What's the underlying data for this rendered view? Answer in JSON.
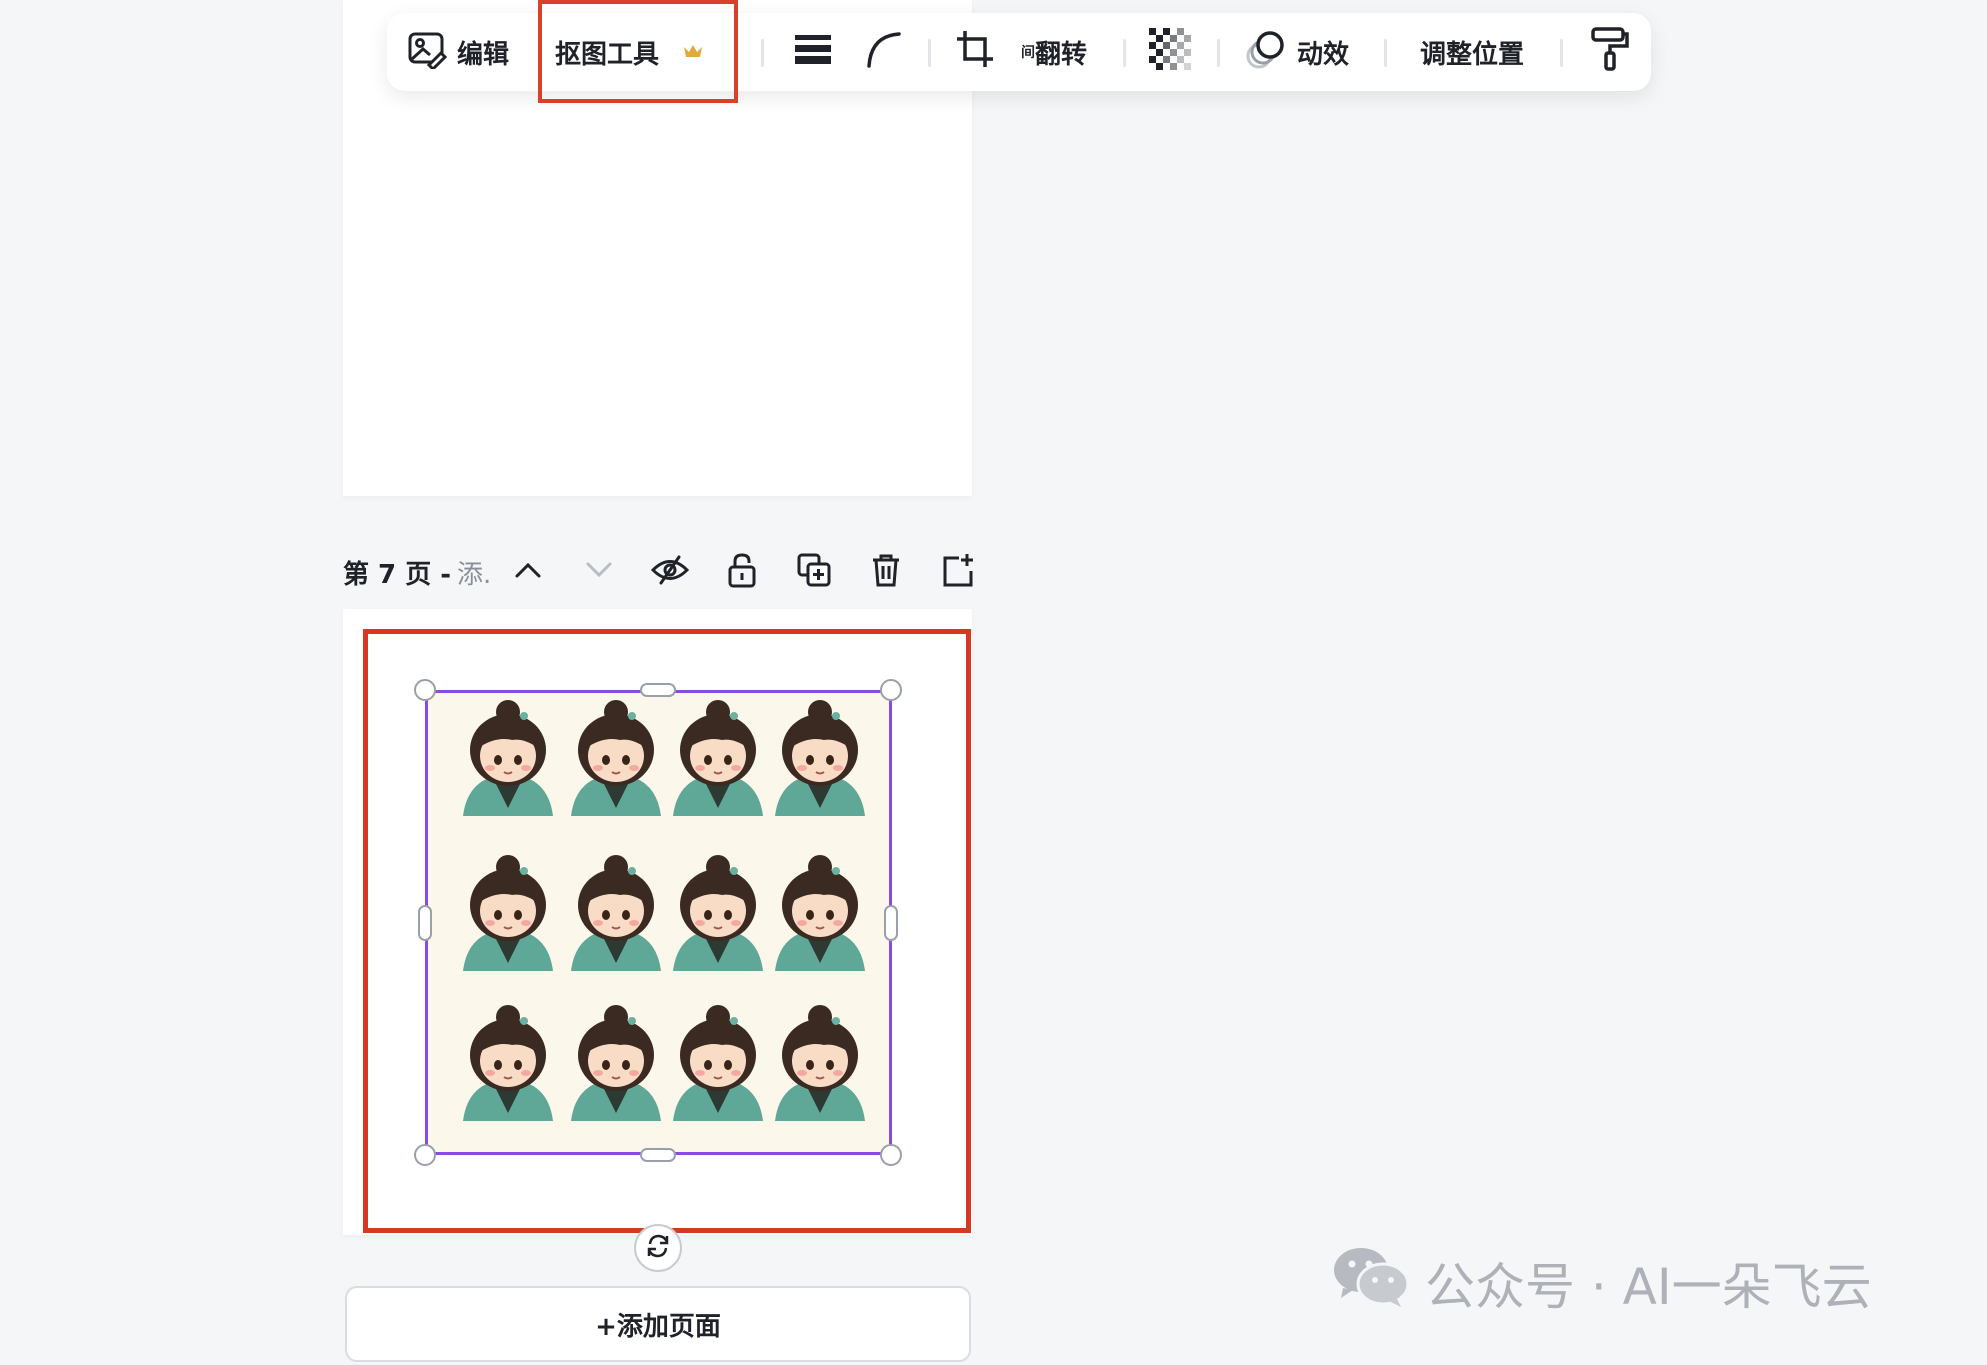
{
  "toolbar": {
    "edit_label": "编辑",
    "cutout_label": "抠图工具",
    "flip_label": "翻转",
    "flip_prefix": "间",
    "animation_label": "动效",
    "position_label": "调整位置",
    "premium_icon": "crown-icon",
    "highlight_color": "#d8402b"
  },
  "page": {
    "title": "第 7 页 -",
    "add_note": "添.",
    "add_page_label": "+添加页面"
  },
  "selection": {
    "frame_color": "#8a4ce0",
    "highlight_color": "#d43a22"
  },
  "watermark": {
    "text": "公众号 · AI一朵飞云",
    "icon": "wechat-icon"
  }
}
